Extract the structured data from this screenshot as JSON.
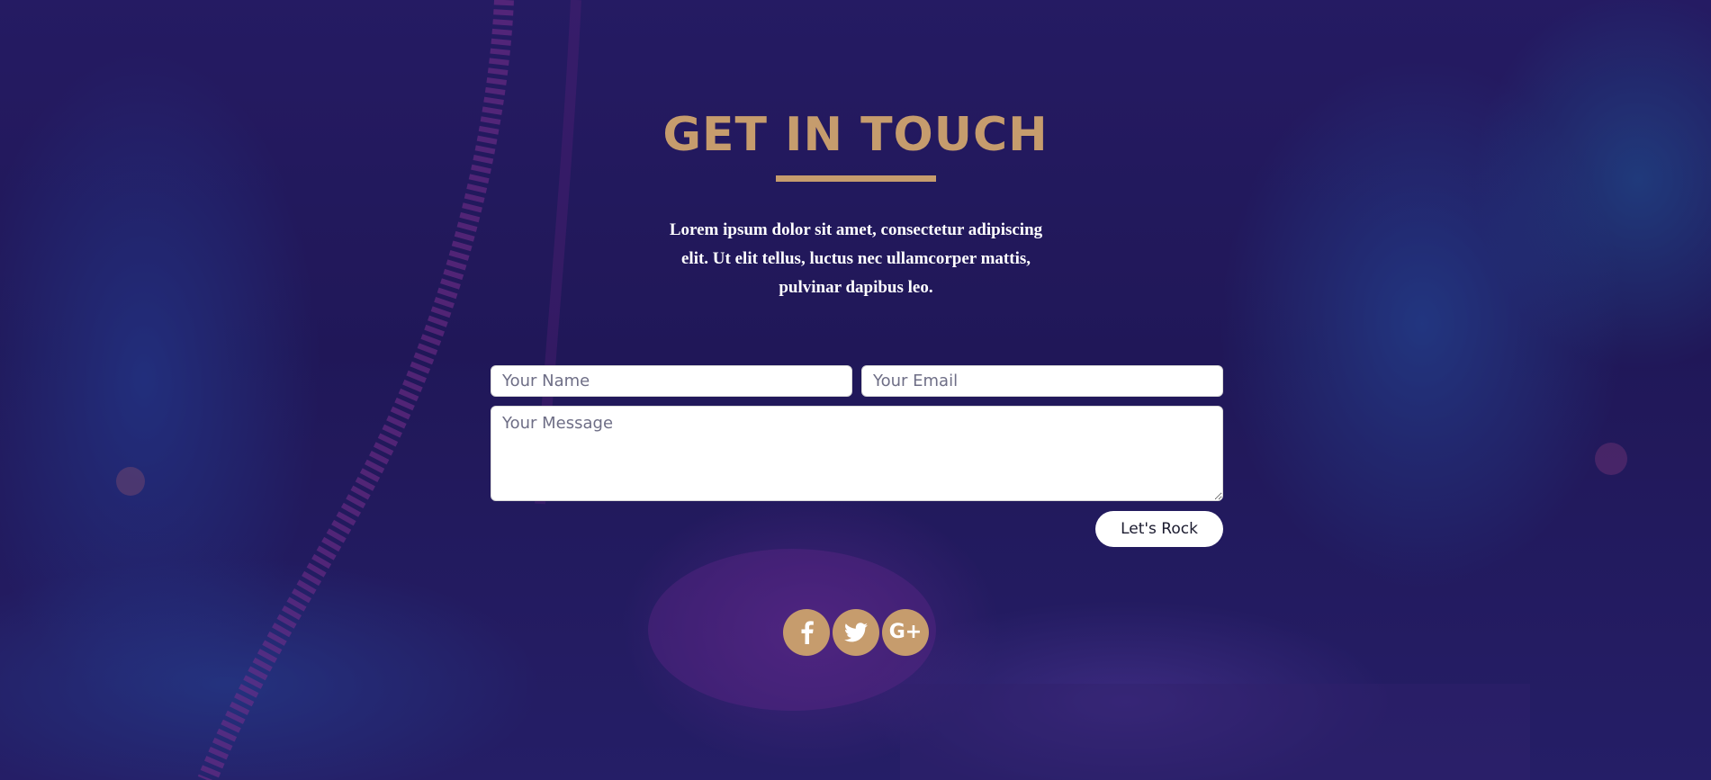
{
  "section": {
    "title": "GET IN TOUCH",
    "intro": "Lorem ipsum dolor sit amet, consectetur adipiscing elit. Ut elit tellus, luctus nec ullamcorper mattis, pulvinar dapibus leo."
  },
  "form": {
    "name_placeholder": "Your Name",
    "email_placeholder": "Your Email",
    "message_placeholder": "Your Message",
    "submit_label": "Let's Rock"
  },
  "social": {
    "items": [
      {
        "icon": "facebook-icon"
      },
      {
        "icon": "twitter-icon"
      },
      {
        "icon": "google-plus-icon",
        "glyph": "G+"
      }
    ]
  },
  "colors": {
    "accent": "#c69c6d",
    "background": "#241a5e",
    "text": "#ffffff"
  }
}
